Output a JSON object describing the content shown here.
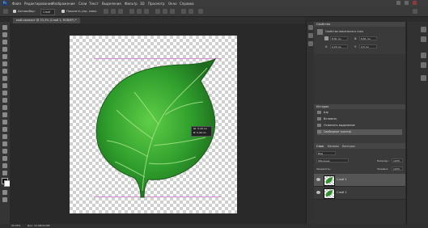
{
  "app": {
    "logo": "Ps"
  },
  "menu": [
    "Файл",
    "Редактирование",
    "Изображение",
    "Слои",
    "Текст",
    "Выделение",
    "Фильтр",
    "3D",
    "Просмотр",
    "Окно",
    "Справка"
  ],
  "options": {
    "mode_label": "Автовыбор:",
    "mode_value": "Слой",
    "show_controls": "Показать упр. элем."
  },
  "document": {
    "tab_title": "мой-самолрт @ 33,3% (Слой 1, RGB/8*) *"
  },
  "tooltip": {
    "w": "Ш: 5,49 см",
    "h": "В: 5,49 см"
  },
  "status": {
    "zoom": "33,33%",
    "info": "Док: 12,3M/24,6M"
  },
  "properties": {
    "title": "Свойства",
    "subtitle": "Свойства пиксельного слоя",
    "w_label": "Ш:",
    "w_value": "8,81 см",
    "h_label": "В:",
    "h_value": "8,81 см",
    "x_label": "X:",
    "x_value": "4,24 см",
    "y_label": "Y:",
    "y_value": "4,5 см"
  },
  "history": {
    "title": "История",
    "items": [
      "Шр",
      "Вставить",
      "Отменить выделение",
      "Свободное трансф."
    ]
  },
  "layers": {
    "tabs": [
      "Слои",
      "Каналы",
      "Контуры"
    ],
    "kind": "Вид",
    "blend": "Обычные",
    "opacity_label": "Непрозр.:",
    "opacity_value": "100%",
    "lock_label": "Закрепить:",
    "fill_label": "Заливка:",
    "fill_value": "100%",
    "rows": [
      {
        "name": "Слой 2",
        "selected": true,
        "has_leaf": true
      },
      {
        "name": "Слой 1",
        "selected": false,
        "has_leaf": true
      }
    ]
  },
  "colors": {
    "leaf": "#2e8f2e",
    "leaf_light": "#4cbc3c",
    "selection_guide": "#d07ad0"
  }
}
